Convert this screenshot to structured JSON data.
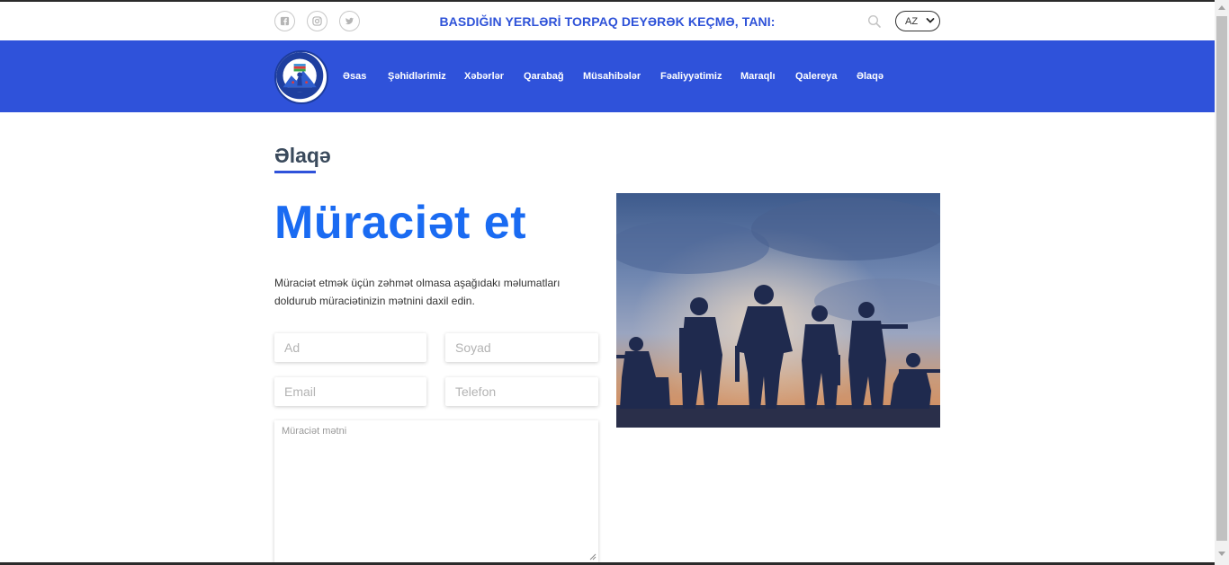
{
  "topbar": {
    "slogan": "BASDIĞIN YERLƏRİ TORPAQ DEYƏRƏK KEÇMƏ, TANI:",
    "social": [
      "facebook-icon",
      "instagram-icon",
      "twitter-icon"
    ],
    "language": "AZ"
  },
  "nav": {
    "items": [
      "Əsas",
      "Şəhidlərimiz",
      "Xəbərlər",
      "Qarabağ",
      "Müsahibələr",
      "Fəaliyyətimiz",
      "Maraqlı",
      "Qalereya",
      "Əlaqə"
    ]
  },
  "main": {
    "page_title": "Əlaqə",
    "heading": "Müraciət et",
    "intro": "Müraciət etmək üçün zəhmət olmasa aşağıdakı məlumatları doldurub müraciətinizin mətnini daxil edin.",
    "form": {
      "name_placeholder": "Ad",
      "surname_placeholder": "Soyad",
      "email_placeholder": "Email",
      "phone_placeholder": "Telefon",
      "message_placeholder": "Müraciət mətni"
    }
  },
  "colors": {
    "brand_blue": "#2f52da",
    "heading_blue": "#1a6bf2"
  }
}
